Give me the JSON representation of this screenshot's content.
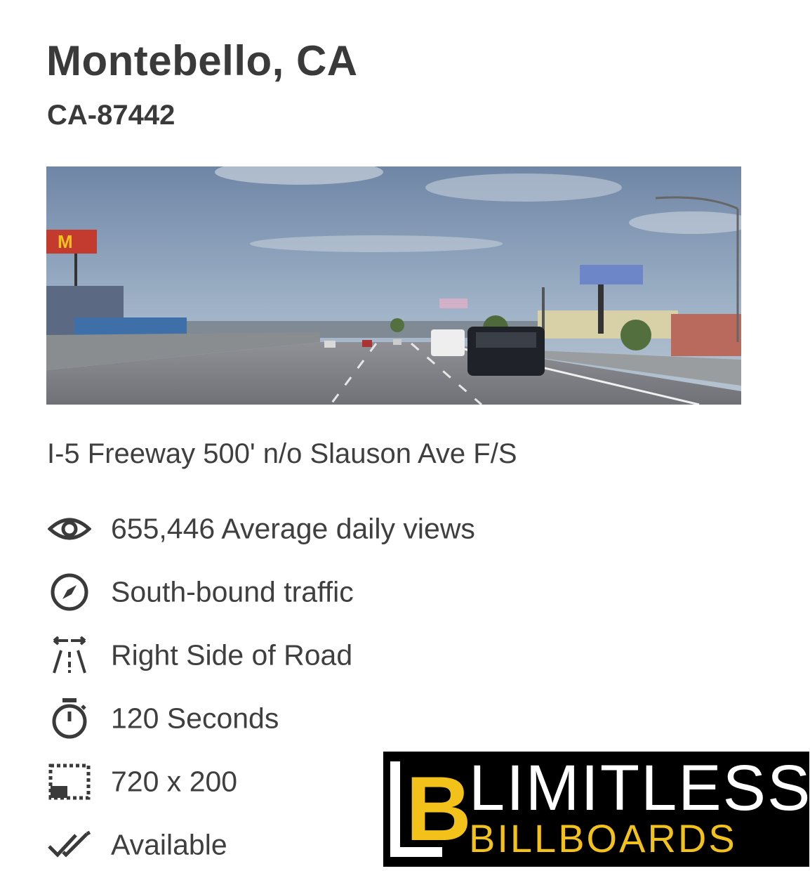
{
  "listing": {
    "title": "Montebello, CA",
    "code": "CA-87442",
    "address": "I-5 Freeway 500' n/o Slauson Ave F/S"
  },
  "details": [
    {
      "icon": "eye-icon",
      "text": "655,446 Average daily views"
    },
    {
      "icon": "compass-icon",
      "text": "South-bound traffic"
    },
    {
      "icon": "road-side-icon",
      "text": "Right Side of Road"
    },
    {
      "icon": "stopwatch-icon",
      "text": "120 Seconds"
    },
    {
      "icon": "dimensions-icon",
      "text": "720 x 200"
    },
    {
      "icon": "double-check-icon",
      "text": "Available"
    }
  ],
  "logo": {
    "monogram_l": "L",
    "monogram_b": "B",
    "word_top": "LIMITLESS",
    "word_bottom": "BILLBOARDS",
    "accent_color": "#f2c21b",
    "background_color": "#000000"
  }
}
